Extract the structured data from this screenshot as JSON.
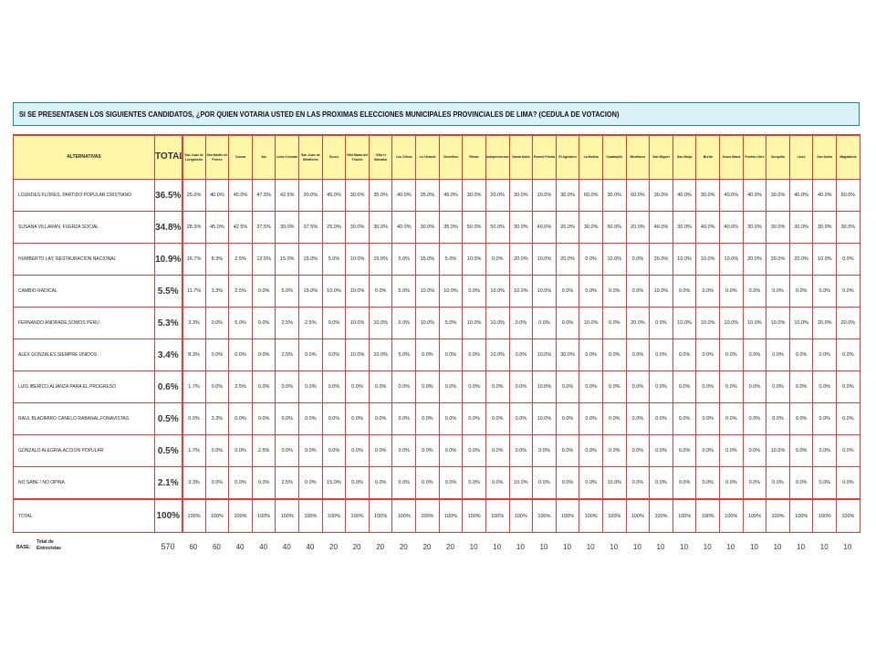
{
  "title": "SI SE PRESENTASEN LOS SIGUIENTES CANDIDATOS, ¿POR QUIEN VOTARIA USTED EN LAS PROXIMAS ELECCIONES MUNICIPALES PROVINCIALES DE LIMA? (CEDULA DE VOTACION)",
  "header": {
    "alternatives": "ALTERNATIVAS",
    "total": "TOTAL",
    "districts": [
      "San Juan de Lurigancho",
      "San Martin de Porres",
      "Comas",
      "Ate",
      "Lima Cercado",
      "San Juan de Miraflores",
      "Surco",
      "Villa Maria del Triunfo",
      "Villa el Salvador",
      "Los Olivos",
      "La Victoria",
      "Chorrillos",
      "Rimac",
      "Independencia",
      "Santa Anita",
      "Puente Piedra",
      "El Agustino",
      "La Molina",
      "Carabayllo",
      "Miraflores",
      "San Miguel",
      "San Borja",
      "Breña",
      "Jesus María",
      "Pueblo Libre",
      "Surquillo",
      "Lince",
      "San Isidro",
      "Magdalena"
    ]
  },
  "rows": [
    {
      "label": "LOURDES FLORES, PARTIDO POPULAR CRISTIANO",
      "total": "36.5%",
      "values": [
        "25.0%",
        "40.0%",
        "45.0%",
        "47.5%",
        "42.5%",
        "30.0%",
        "45.0%",
        "30.0%",
        "35.0%",
        "40.0%",
        "35.0%",
        "45.0%",
        "30.0%",
        "20.0%",
        "30.0%",
        "10.0%",
        "30.0%",
        "60.0%",
        "30.0%",
        "60.0%",
        "30.0%",
        "40.0%",
        "30.0%",
        "40.0%",
        "40.0%",
        "30.0%",
        "40.0%",
        "40.0%",
        "50.0%"
      ]
    },
    {
      "label": "SUSANA VILLARAN, FUERZA SOCIAL",
      "total": "34.8%",
      "values": [
        "28.3%",
        "45.0%",
        "42.5%",
        "37.5%",
        "30.0%",
        "37.5%",
        "25.0%",
        "30.0%",
        "30.0%",
        "40.0%",
        "30.0%",
        "35.0%",
        "50.0%",
        "50.0%",
        "30.0%",
        "40.0%",
        "20.0%",
        "30.0%",
        "50.0%",
        "20.0%",
        "40.0%",
        "30.0%",
        "40.0%",
        "40.0%",
        "30.0%",
        "30.0%",
        "30.0%",
        "30.0%",
        "30.0%"
      ]
    },
    {
      "label": "HUMBERTO LAY, RESTAURACION NACIONAL",
      "total": "10.9%",
      "values": [
        "16.7%",
        "8.3%",
        "2.5%",
        "12.5%",
        "15.0%",
        "15.0%",
        "5.0%",
        "10.0%",
        "15.0%",
        "5.0%",
        "15.0%",
        "5.0%",
        "10.0%",
        "0.0%",
        "20.0%",
        "10.0%",
        "20.0%",
        "0.0%",
        "10.0%",
        "0.0%",
        "20.0%",
        "10.0%",
        "10.0%",
        "10.0%",
        "20.0%",
        "20.0%",
        "20.0%",
        "10.0%",
        "0.0%"
      ]
    },
    {
      "label": "CAMBIO RADICAL",
      "total": "5.5%",
      "values": [
        "11.7%",
        "3.3%",
        "2.5%",
        "0.0%",
        "5.0%",
        "15.0%",
        "10.0%",
        "10.0%",
        "0.0%",
        "5.0%",
        "10.0%",
        "10.0%",
        "0.0%",
        "10.0%",
        "10.0%",
        "10.0%",
        "0.0%",
        "0.0%",
        "0.0%",
        "0.0%",
        "10.0%",
        "0.0%",
        "0.0%",
        "0.0%",
        "0.0%",
        "0.0%",
        "0.0%",
        "0.0%",
        "0.0%"
      ]
    },
    {
      "label": "FERNANDO ANDRADE,SOMOS PERU",
      "total": "5.3%",
      "values": [
        "3.3%",
        "0.0%",
        "5.0%",
        "0.0%",
        "2.5%",
        "2.5%",
        "0.0%",
        "10.0%",
        "10.0%",
        "5.0%",
        "10.0%",
        "5.0%",
        "10.0%",
        "10.0%",
        "0.0%",
        "0.0%",
        "0.0%",
        "10.0%",
        "0.0%",
        "20.0%",
        "0.0%",
        "10.0%",
        "10.0%",
        "10.0%",
        "10.0%",
        "10.0%",
        "10.0%",
        "20.0%",
        "20.0%"
      ]
    },
    {
      "label": "ALEX GONZALES,SIEMPRE UNIDOS",
      "total": "3.4%",
      "values": [
        "8.3%",
        "0.0%",
        "0.0%",
        "0.0%",
        "2.5%",
        "0.0%",
        "0.0%",
        "10.0%",
        "10.0%",
        "5.0%",
        "0.0%",
        "0.0%",
        "0.0%",
        "10.0%",
        "0.0%",
        "10.0%",
        "30.0%",
        "0.0%",
        "0.0%",
        "0.0%",
        "0.0%",
        "0.0%",
        "0.0%",
        "0.0%",
        "0.0%",
        "0.0%",
        "0.0%",
        "0.0%",
        "0.0%"
      ]
    },
    {
      "label": "LUIS IBERICO,ALIANZA PARA EL PROGRESO",
      "total": "0.6%",
      "values": [
        "1.7%",
        "0.0%",
        "2.5%",
        "0.0%",
        "0.0%",
        "0.0%",
        "0.0%",
        "0.0%",
        "0.0%",
        "0.0%",
        "0.0%",
        "0.0%",
        "0.0%",
        "0.0%",
        "0.0%",
        "10.0%",
        "0.0%",
        "0.0%",
        "0.0%",
        "0.0%",
        "0.0%",
        "0.0%",
        "0.0%",
        "0.0%",
        "0.0%",
        "0.0%",
        "0.0%",
        "0.0%",
        "0.0%"
      ]
    },
    {
      "label": "RAUL BLADIMIRO CANELO RABANAL,FONAVISTAS",
      "total": "0.5%",
      "values": [
        "0.0%",
        "3.3%",
        "0.0%",
        "0.0%",
        "0.0%",
        "0.0%",
        "0.0%",
        "0.0%",
        "0.0%",
        "0.0%",
        "0.0%",
        "0.0%",
        "0.0%",
        "0.0%",
        "0.0%",
        "10.0%",
        "0.0%",
        "0.0%",
        "0.0%",
        "0.0%",
        "0.0%",
        "0.0%",
        "0.0%",
        "0.0%",
        "0.0%",
        "0.0%",
        "0.0%",
        "0.0%",
        "0.0%"
      ]
    },
    {
      "label": "GONZALO ALEGRIA,ACCION POPULAR",
      "total": "0.5%",
      "values": [
        "1.7%",
        "0.0%",
        "0.0%",
        "2.5%",
        "0.0%",
        "0.0%",
        "0.0%",
        "0.0%",
        "0.0%",
        "0.0%",
        "0.0%",
        "0.0%",
        "0.0%",
        "0.0%",
        "0.0%",
        "0.0%",
        "0.0%",
        "0.0%",
        "0.0%",
        "0.0%",
        "0.0%",
        "0.0%",
        "0.0%",
        "0.0%",
        "0.0%",
        "10.0%",
        "0.0%",
        "0.0%",
        "0.0%"
      ]
    },
    {
      "label": "NO SABE / NO OPINA",
      "total": "2.1%",
      "values": [
        "3.3%",
        "0.0%",
        "0.0%",
        "0.0%",
        "2.5%",
        "0.0%",
        "15.0%",
        "0.0%",
        "0.0%",
        "0.0%",
        "0.0%",
        "0.0%",
        "0.0%",
        "0.0%",
        "10.0%",
        "0.0%",
        "0.0%",
        "0.0%",
        "10.0%",
        "0.0%",
        "0.0%",
        "0.0%",
        "0.0%",
        "0.0%",
        "0.0%",
        "0.0%",
        "0.0%",
        "0.0%",
        "0.0%"
      ]
    }
  ],
  "total_row": {
    "label": "TOTAL",
    "total": "100%",
    "values": [
      "100%",
      "100%",
      "100%",
      "100%",
      "100%",
      "100%",
      "100%",
      "100%",
      "100%",
      "100%",
      "100%",
      "100%",
      "100%",
      "100%",
      "100%",
      "100%",
      "100%",
      "100%",
      "100%",
      "100%",
      "100%",
      "100%",
      "100%",
      "100%",
      "100%",
      "100%",
      "100%",
      "100%",
      "100%"
    ]
  },
  "base": {
    "label": "BASE:",
    "sublabel": "Total de Entrevistas",
    "total": "570",
    "values": [
      "60",
      "60",
      "40",
      "40",
      "40",
      "40",
      "20",
      "20",
      "20",
      "20",
      "20",
      "20",
      "10",
      "10",
      "10",
      "10",
      "10",
      "10",
      "10",
      "10",
      "10",
      "10",
      "10",
      "10",
      "10",
      "10",
      "10",
      "10",
      "10"
    ]
  },
  "colors": {
    "grid_red": "#e33a3a",
    "header_yellow": "#fff6a8",
    "title_bg": "#d9f1f5",
    "title_border": "#1b8f8f"
  }
}
